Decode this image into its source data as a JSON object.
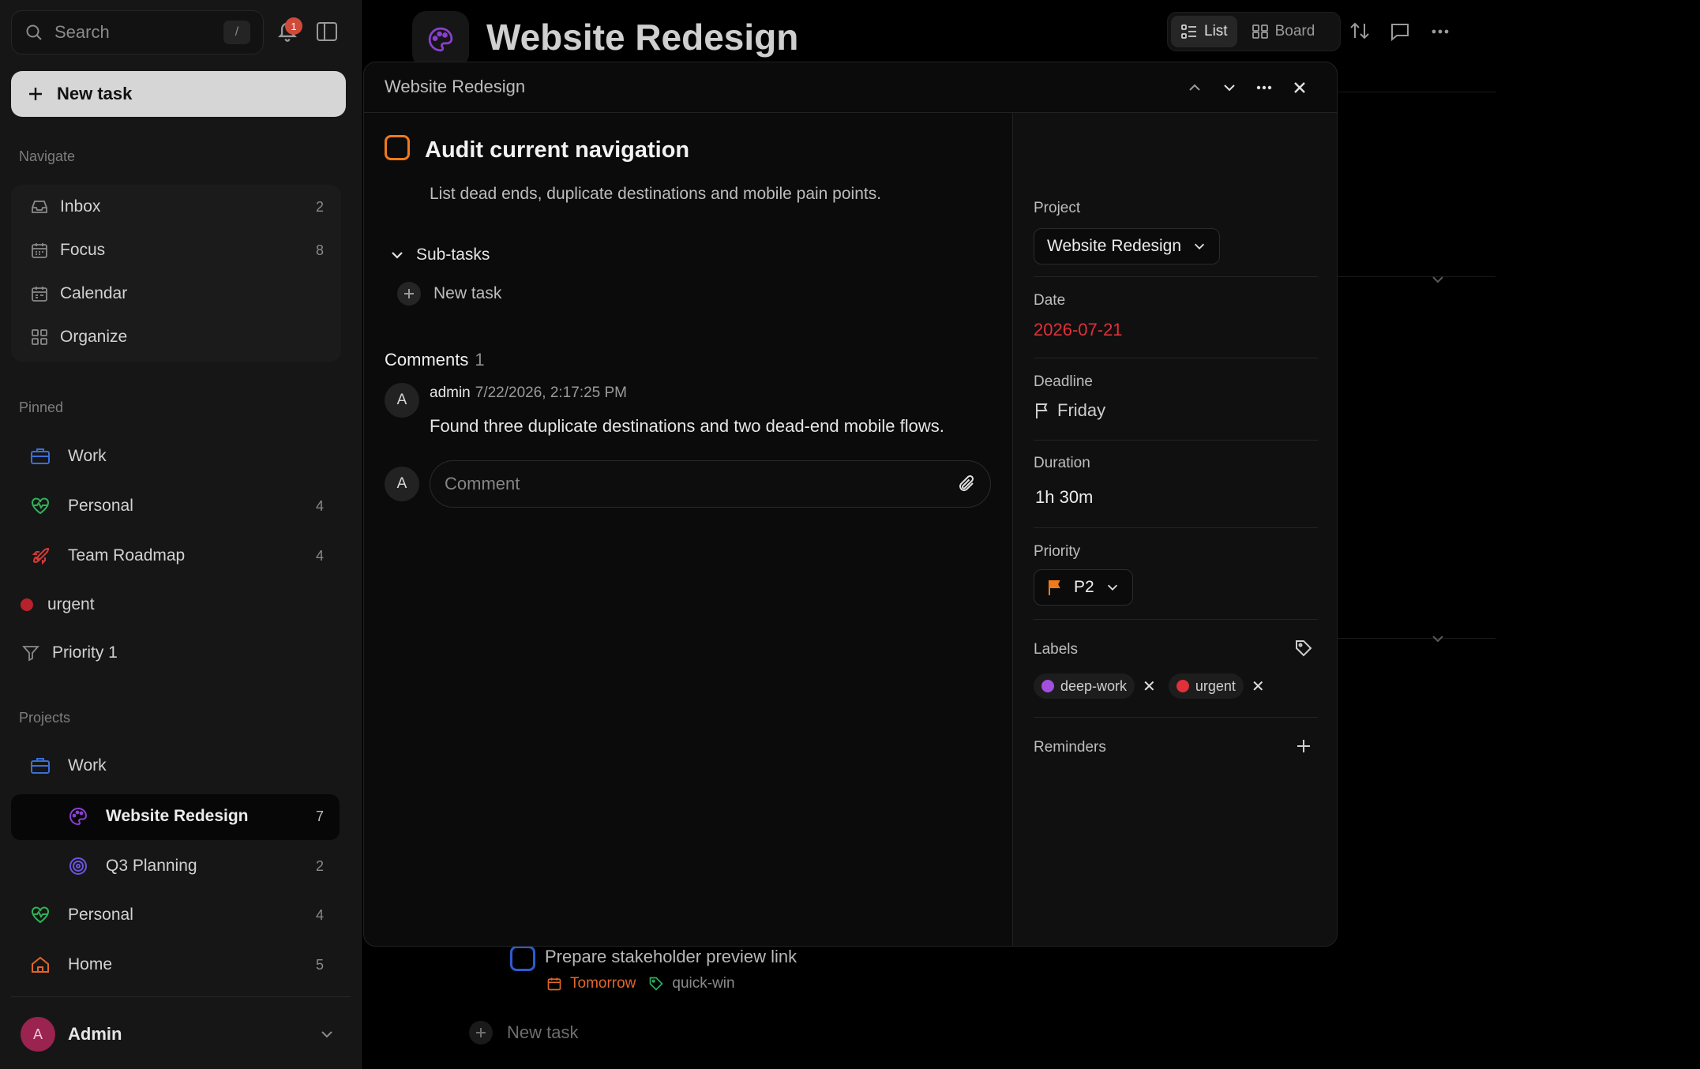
{
  "sidebar": {
    "search_placeholder": "Search",
    "search_shortcut": "/",
    "notif_count": "1",
    "new_task_label": "New task",
    "navigate_label": "Navigate",
    "nav": [
      {
        "label": "Inbox",
        "count": "2"
      },
      {
        "label": "Focus",
        "count": "8"
      },
      {
        "label": "Calendar",
        "count": ""
      },
      {
        "label": "Organize",
        "count": ""
      }
    ],
    "pinned_label": "Pinned",
    "pinned": [
      {
        "label": "Work",
        "count": ""
      },
      {
        "label": "Personal",
        "count": "4"
      },
      {
        "label": "Team Roadmap",
        "count": "4"
      },
      {
        "label": "urgent",
        "count": ""
      },
      {
        "label": "Priority 1",
        "count": ""
      }
    ],
    "projects_label": "Projects",
    "projects": [
      {
        "label": "Work",
        "count": ""
      },
      {
        "label": "Website Redesign",
        "count": "7"
      },
      {
        "label": "Q3 Planning",
        "count": "2"
      },
      {
        "label": "Personal",
        "count": "4"
      },
      {
        "label": "Home",
        "count": "5"
      }
    ],
    "user": {
      "initial": "A",
      "name": "Admin"
    }
  },
  "main": {
    "title": "Website Redesign",
    "view_list": "List",
    "view_board": "Board",
    "bg_task": {
      "title": "Prepare stakeholder preview link",
      "date": "Tomorrow",
      "label": "quick-win"
    },
    "bg_new_task": "New task"
  },
  "modal": {
    "breadcrumb": "Website Redesign",
    "task": {
      "title": "Audit current navigation",
      "description": "List dead ends, duplicate destinations and mobile pain points."
    },
    "subtasks_label": "Sub-tasks",
    "subtask_new": "New task",
    "comments_label": "Comments",
    "comments_count": "1",
    "comment": {
      "initial": "A",
      "author": "admin",
      "date": "7/22/2026, 2:17:25 PM",
      "body": "Found three duplicate destinations and two dead-end mobile flows."
    },
    "comment_placeholder": "Comment",
    "me_initial": "A",
    "props": {
      "project_label": "Project",
      "project_value": "Website Redesign",
      "date_label": "Date",
      "date_value": "2026-07-21",
      "deadline_label": "Deadline",
      "deadline_value": "Friday",
      "duration_label": "Duration",
      "duration_value": "1h 30m",
      "priority_label": "Priority",
      "priority_value": "P2",
      "labels_label": "Labels",
      "labels": [
        {
          "name": "deep-work",
          "color": "#a24fe0"
        },
        {
          "name": "urgent",
          "color": "#e0303a"
        }
      ],
      "reminders_label": "Reminders"
    }
  },
  "colors": {
    "accent_orange": "#f07a1a",
    "date_red": "#e0303a",
    "website_purple": "#8a3fd0",
    "work_blue": "#3a6fd8",
    "personal_green": "#2fb15a",
    "rocket_red": "#d23a3a",
    "home_orange": "#e0662a"
  }
}
